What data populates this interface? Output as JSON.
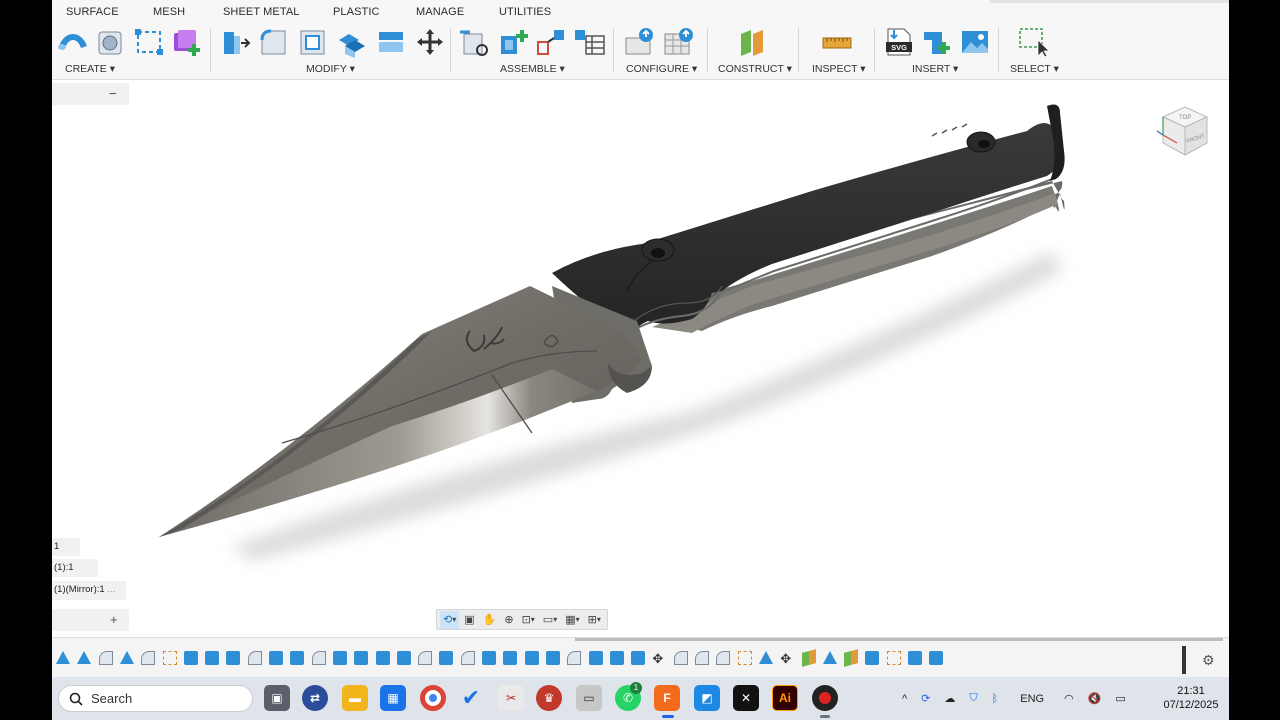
{
  "tabs": [
    "SURFACE",
    "MESH",
    "SHEET METAL",
    "PLASTIC",
    "MANAGE",
    "UTILITIES"
  ],
  "groups": {
    "create": "CREATE",
    "modify": "MODIFY",
    "assemble": "ASSEMBLE",
    "configure": "CONFIGURE",
    "construct": "CONSTRUCT",
    "inspect": "INSPECT",
    "insert": "INSERT",
    "select": "SELECT"
  },
  "browser": {
    "collapse": "−",
    "items": [
      "1",
      "(1):1",
      "(1)(Mirror):1"
    ],
    "more": "...",
    "expand": "+"
  },
  "viewcube": {
    "top": "TOP",
    "front": "FRONT"
  },
  "insert_svg_label": "SVG",
  "taskbar": {
    "search_placeholder": "Search",
    "lang": "ENG",
    "time": "21:31",
    "date": "07/12/2025",
    "whatsapp_badge": "1",
    "illustrator": "Ai",
    "fusion_badge": "F"
  },
  "colors": {
    "accent": "#1c84c6",
    "handle": "#2e2e2e",
    "blade": "#7d7a73"
  }
}
